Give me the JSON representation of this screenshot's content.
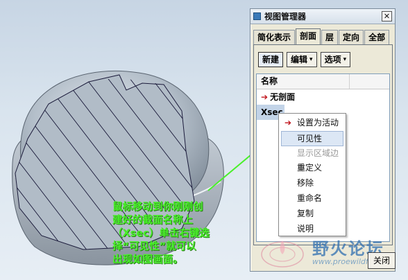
{
  "dialog": {
    "title": "视图管理器",
    "close_glyph": "✕",
    "tabs": [
      {
        "label": "简化表示",
        "active": false
      },
      {
        "label": "剖面",
        "active": true
      },
      {
        "label": "层",
        "active": false
      },
      {
        "label": "定向",
        "active": false
      },
      {
        "label": "全部",
        "active": false
      }
    ],
    "toolbar": {
      "new_label": "新建",
      "edit_label": "编辑",
      "options_label": "选项",
      "dropdown_glyph": "▾"
    },
    "list": {
      "header_name": "名称",
      "rows": [
        {
          "label": "无剖面",
          "active_marker": true
        },
        {
          "label": "Xsec",
          "active_marker": false
        }
      ]
    },
    "close_button_label": "关闭"
  },
  "context_menu": {
    "items": [
      {
        "label": "设置为活动",
        "icon": "red-arrow-icon",
        "state": "normal"
      },
      {
        "label": "可见性",
        "state": "hover"
      },
      {
        "label": "显示区域边界",
        "state": "disabled"
      },
      {
        "label": "重定义",
        "state": "normal"
      },
      {
        "label": "移除",
        "state": "normal"
      },
      {
        "label": "重命名",
        "state": "normal"
      },
      {
        "label": "复制",
        "state": "normal"
      },
      {
        "label": "说明",
        "state": "normal"
      }
    ]
  },
  "annotation": {
    "lines": [
      "鼠标移动到你刚刚创",
      "建好的截面名称上",
      "（Xsec）单击右键选",
      "择“可见性”就可以",
      "出现如图画面。"
    ],
    "color": "#49f02a"
  },
  "watermark": {
    "text": "野火论坛",
    "url": "www.proewildfire.cn"
  },
  "colors": {
    "model_fill": "#b9c4ce",
    "hatch": "#1a1a3a",
    "arrow": "#c0141c",
    "selection": "#c3d4e8"
  }
}
